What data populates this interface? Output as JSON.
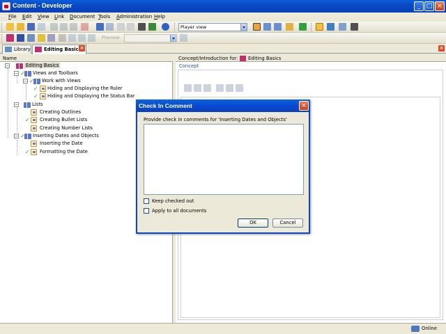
{
  "window": {
    "title": "Content - Developer",
    "min_label": "_",
    "max_label": "□",
    "close_label": "×"
  },
  "menu": [
    "File",
    "Edit",
    "View",
    "Link",
    "Document",
    "Tools",
    "Administration",
    "Help"
  ],
  "toolbar": {
    "view_mode": "Player view",
    "preview_label": "Preview:"
  },
  "tabs": [
    {
      "label": "Library"
    },
    {
      "label": "Editing Basics"
    }
  ],
  "tab_close_label": "×",
  "left_pane": {
    "header": "Name"
  },
  "tree": [
    {
      "label": "Editing Basics"
    },
    {
      "label": "Views and Toolbars"
    },
    {
      "label": "Work with Views"
    },
    {
      "label": "Hiding and Displaying the Ruler"
    },
    {
      "label": "Hiding and Displaying the Status Bar"
    },
    {
      "label": "Lists"
    },
    {
      "label": "Creating Outlines"
    },
    {
      "label": "Creating Bullet Lists"
    },
    {
      "label": "Creating Number Lists"
    },
    {
      "label": "Inserting Dates and Objects"
    },
    {
      "label": "Inserting the Date"
    },
    {
      "label": "Formatting the Date"
    }
  ],
  "right_pane": {
    "header_prefix": "Concept/Introduction for:",
    "header_doc": "Editing Basics",
    "section": "Concept"
  },
  "dialog": {
    "title": "Check In Comment",
    "prompt": "Provide check in comments for 'Inserting Dates and Objects'",
    "comment_value": "",
    "keep_checked_out": "Keep checked out",
    "apply_all": "Apply to all documents",
    "ok": "OK",
    "cancel": "Cancel",
    "close_label": "×"
  },
  "status": {
    "online": "Online"
  }
}
